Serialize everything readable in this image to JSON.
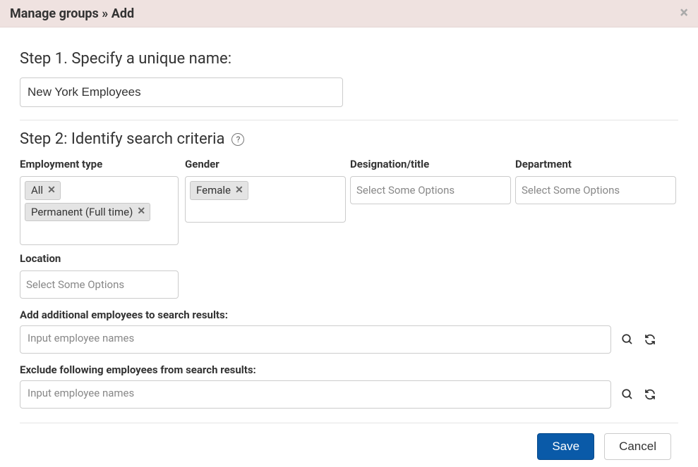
{
  "header": {
    "title": "Manage groups » Add"
  },
  "step1": {
    "title": "Step 1. Specify a unique name:",
    "name_value": "New York Employees"
  },
  "step2": {
    "title": "Step 2: Identify search criteria",
    "fields": {
      "employment_type": {
        "label": "Employment type",
        "tags": [
          "All",
          "Permanent (Full time)"
        ]
      },
      "gender": {
        "label": "Gender",
        "tags": [
          "Female"
        ]
      },
      "designation": {
        "label": "Designation/title",
        "placeholder": "Select Some Options"
      },
      "department": {
        "label": "Department",
        "placeholder": "Select Some Options"
      },
      "location": {
        "label": "Location",
        "placeholder": "Select Some Options"
      }
    },
    "add_employees": {
      "label": "Add additional employees to search results:",
      "placeholder": "Input employee names"
    },
    "exclude_employees": {
      "label": "Exclude following employees from search results:",
      "placeholder": "Input employee names"
    }
  },
  "footer": {
    "save": "Save",
    "cancel": "Cancel"
  }
}
